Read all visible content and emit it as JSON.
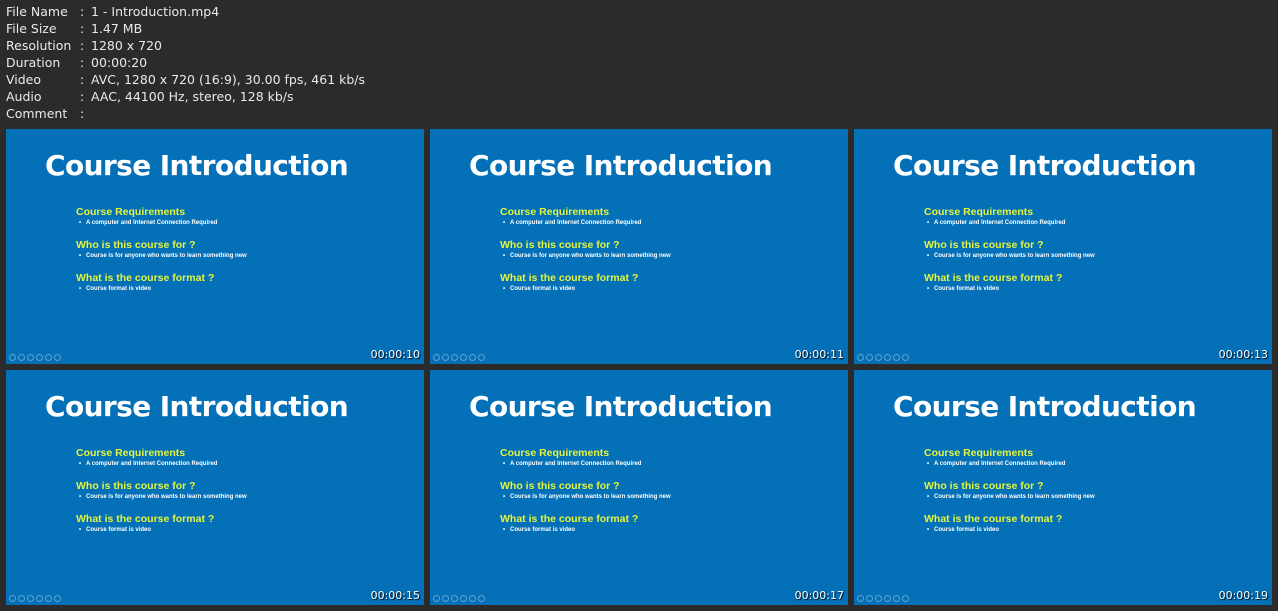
{
  "file_info": [
    {
      "label": "File Name",
      "value": "1 - Introduction.mp4"
    },
    {
      "label": "File Size",
      "value": "1.47 MB"
    },
    {
      "label": "Resolution",
      "value": "1280 x 720"
    },
    {
      "label": "Duration",
      "value": "00:00:20"
    },
    {
      "label": "Video",
      "value": "AVC, 1280 x 720 (16:9), 30.00 fps, 461 kb/s"
    },
    {
      "label": "Audio",
      "value": "AAC, 44100 Hz, stereo, 128 kb/s"
    },
    {
      "label": "Comment",
      "value": ""
    }
  ],
  "separator": ":",
  "slide": {
    "title": "Course Introduction",
    "bullet_glyph": "•",
    "sections": [
      {
        "heading": "Course Requirements",
        "bullet": "A computer and Internet Connection Required"
      },
      {
        "heading": "Who is this course for ?",
        "bullet": "Course is for anyone who wants to learn something new"
      },
      {
        "heading": "What is the course format ?",
        "bullet": "Course format is video"
      }
    ],
    "toolbar_icons": [
      "prev-icon",
      "next-icon",
      "pen-icon",
      "slides-icon",
      "zoom-icon",
      "more-icon"
    ]
  },
  "thumbnails": [
    {
      "timestamp": "00:00:10"
    },
    {
      "timestamp": "00:00:11"
    },
    {
      "timestamp": "00:00:13"
    },
    {
      "timestamp": "00:00:15"
    },
    {
      "timestamp": "00:00:17"
    },
    {
      "timestamp": "00:00:19"
    }
  ],
  "colors": {
    "background": "#2b2b2b",
    "slide_background": "#0370b8",
    "heading_yellow": "#e6f53a",
    "text_white": "#ffffff"
  }
}
